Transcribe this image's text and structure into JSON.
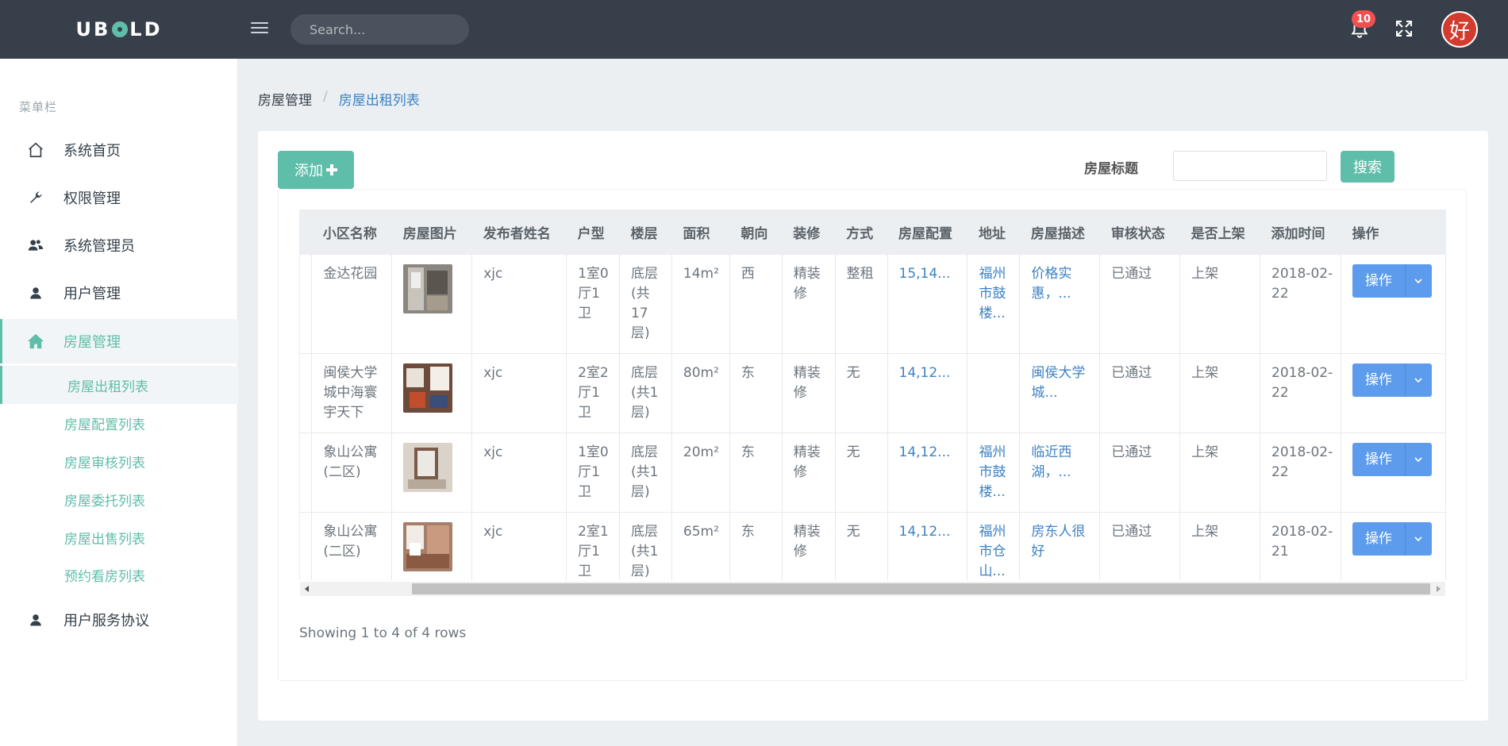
{
  "brand": {
    "name_pre": "UB",
    "name_post": "LD"
  },
  "topbar": {
    "search_placeholder": "Search...",
    "notification_count": "10",
    "avatar_char": "好"
  },
  "sidebar": {
    "section_title": "菜单栏",
    "items": [
      {
        "label": "系统首页",
        "icon": "home-icon"
      },
      {
        "label": "权限管理",
        "icon": "wrench-icon"
      },
      {
        "label": "系统管理员",
        "icon": "users-icon"
      },
      {
        "label": "用户管理",
        "icon": "user-icon"
      },
      {
        "label": "房屋管理",
        "icon": "house-icon"
      }
    ],
    "subitems": [
      "房屋出租列表",
      "房屋配置列表",
      "房屋审核列表",
      "房屋委托列表",
      "房屋出售列表",
      "预约看房列表"
    ],
    "extra_item": {
      "label": "用户服务协议",
      "icon": "user-icon"
    }
  },
  "breadcrumb": {
    "parent": "房屋管理",
    "current": "房屋出租列表"
  },
  "toolbar": {
    "add_label": "添加",
    "filter_label": "房屋标题",
    "search_label": "搜索"
  },
  "table": {
    "columns": [
      "小区名称",
      "房屋图片",
      "发布者姓名",
      "户型",
      "楼层",
      "面积",
      "朝向",
      "装修",
      "方式",
      "房屋配置",
      "地址",
      "房屋描述",
      "审核状态",
      "是否上架",
      "添加时间",
      "操作"
    ],
    "rows": [
      {
        "community": "金达花园",
        "publisher": "xjc",
        "layout": "1室0厅1卫",
        "floor": "底层(共17层)",
        "area": "14m²",
        "orientation": "西",
        "decoration": "精装修",
        "mode": "整租",
        "config": "15,14...",
        "address": "福州市鼓楼...",
        "desc": "价格实惠，...",
        "audit": "已通过",
        "shelf": "上架",
        "date": "2018-02-22",
        "op": "操作"
      },
      {
        "community": "闽侯大学城中海寰宇天下",
        "publisher": "xjc",
        "layout": "2室2厅1卫",
        "floor": "底层(共1层)",
        "area": "80m²",
        "orientation": "东",
        "decoration": "精装修",
        "mode": "无",
        "config": "14,12...",
        "address": "",
        "desc": "闽侯大学城...",
        "audit": "已通过",
        "shelf": "上架",
        "date": "2018-02-22",
        "op": "操作"
      },
      {
        "community": "象山公寓(二区)",
        "publisher": "xjc",
        "layout": "1室0厅1卫",
        "floor": "底层(共1层)",
        "area": "20m²",
        "orientation": "东",
        "decoration": "精装修",
        "mode": "无",
        "config": "14,12...",
        "address": "福州市鼓楼...",
        "desc": "临近西湖，...",
        "audit": "已通过",
        "shelf": "上架",
        "date": "2018-02-22",
        "op": "操作"
      },
      {
        "community": "象山公寓(二区)",
        "publisher": "xjc",
        "layout": "2室1厅1卫",
        "floor": "底层(共1层)",
        "area": "65m²",
        "orientation": "东",
        "decoration": "精装修",
        "mode": "无",
        "config": "14,12...",
        "address": "福州市仓山...",
        "desc": "房东人很好",
        "audit": "已通过",
        "shelf": "上架",
        "date": "2018-02-21",
        "op": "操作"
      }
    ],
    "pagination_info": "Showing 1 to 4 of 4 rows"
  },
  "colors": {
    "accent": "#5fbeaa",
    "topbar": "#37404a",
    "link": "#3d82c4",
    "op_button": "#5d9cec",
    "badge": "#f05050"
  }
}
